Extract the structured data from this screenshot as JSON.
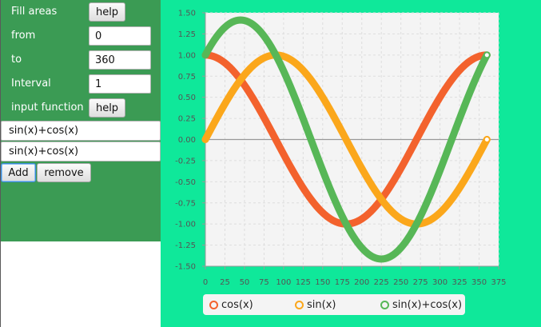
{
  "controls": {
    "fill_areas_label": "Fill areas",
    "help_label": "help",
    "from_label": "from",
    "from_value": "0",
    "to_label": "to",
    "to_value": "360",
    "interval_label": "Interval",
    "interval_value": "1",
    "input_function_label": "input function",
    "functions": [
      "sin(x)+cos(x)",
      "sin(x)+cos(x)"
    ],
    "add_label": "Add",
    "remove_label": "remove"
  },
  "chart_data": {
    "type": "line",
    "x": {
      "min": 0,
      "max": 360,
      "step": 1
    },
    "xlim": [
      0,
      375
    ],
    "ylim": [
      -1.5,
      1.5
    ],
    "xticks": [
      "0",
      "25",
      "50",
      "75",
      "100",
      "125",
      "150",
      "175",
      "200",
      "225",
      "250",
      "275",
      "300",
      "325",
      "350",
      "375"
    ],
    "yticks": [
      "1.50",
      "1.25",
      "1.00",
      "0.75",
      "0.50",
      "0.25",
      "0.00",
      "-0.25",
      "-0.50",
      "-0.75",
      "-1.00",
      "-1.25",
      "-1.50"
    ],
    "grid": true,
    "legend_position": "bottom",
    "series": [
      {
        "name": "cos(x)",
        "expr": "cos",
        "color": "#f3622d"
      },
      {
        "name": "sin(x)",
        "expr": "sin",
        "color": "#fba71b"
      },
      {
        "name": "sin(x)+cos(x)",
        "expr": "sincos",
        "color": "#57b757"
      }
    ]
  }
}
